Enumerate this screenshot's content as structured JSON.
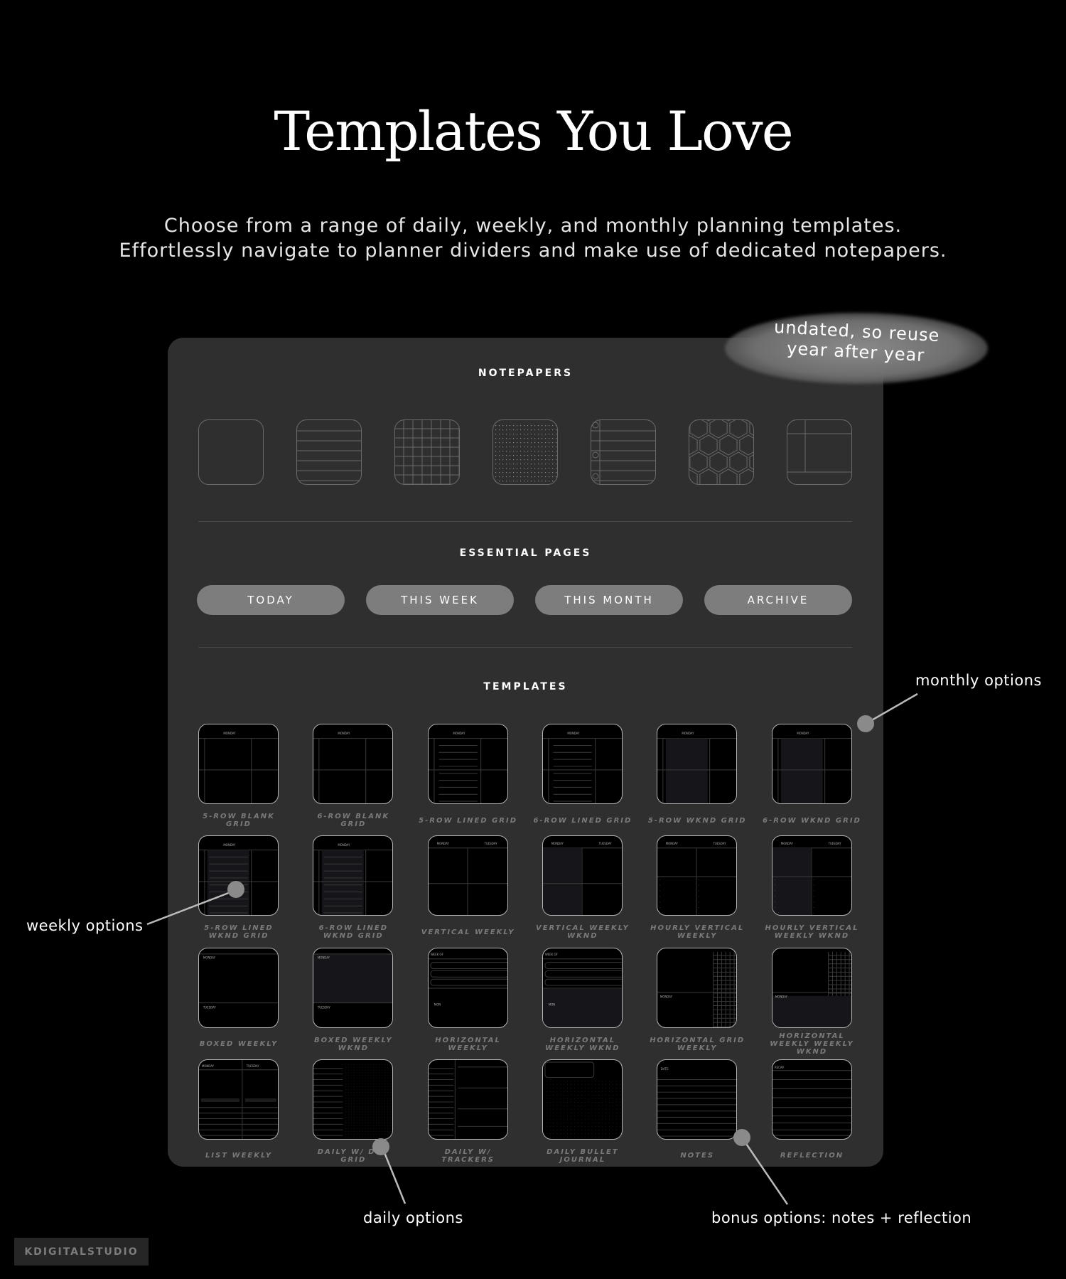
{
  "header": {
    "title": "Templates You Love",
    "subtitle_line1": "Choose from a range of daily, weekly, and monthly planning templates.",
    "subtitle_line2": "Effortlessly navigate to planner dividers and make use of dedicated notepapers."
  },
  "bubble": {
    "line1": "undated, so reuse",
    "line2": "year after year"
  },
  "notepapers": {
    "label": "NOTEPAPERS",
    "items": [
      {
        "icon": "blank-paper-icon",
        "style": "blank"
      },
      {
        "icon": "lined-paper-icon",
        "style": "lined"
      },
      {
        "icon": "grid-paper-icon",
        "style": "grid"
      },
      {
        "icon": "dot-grid-paper-icon",
        "style": "dot"
      },
      {
        "icon": "notebook-paper-icon",
        "style": "notebook"
      },
      {
        "icon": "hexagon-paper-icon",
        "style": "hex"
      },
      {
        "icon": "cornell-paper-icon",
        "style": "cornell"
      }
    ]
  },
  "essential": {
    "label": "ESSENTIAL PAGES",
    "buttons": [
      "TODAY",
      "THIS WEEK",
      "THIS MONTH",
      "ARCHIVE"
    ]
  },
  "templates": {
    "label": "TEMPLATES",
    "items": [
      {
        "label": "5-ROW BLANK GRID",
        "style": "cols",
        "head": "MONDAY"
      },
      {
        "label": "6-ROW BLANK GRID",
        "style": "cols",
        "head": "MONDAY"
      },
      {
        "label": "5-ROW LINED GRID",
        "style": "lined",
        "head": "MONDAY"
      },
      {
        "label": "6-ROW LINED GRID",
        "style": "lined",
        "head": "MONDAY"
      },
      {
        "label": "5-ROW WKND GRID",
        "style": "wknd",
        "head": "MONDAY"
      },
      {
        "label": "6-ROW WKND GRID",
        "style": "wknd",
        "head": "MONDAY"
      },
      {
        "label": "5-ROW LINED WKND GRID",
        "style": "linedwknd",
        "head": "MONDAY"
      },
      {
        "label": "6-ROW LINED WKND GRID",
        "style": "linedwknd",
        "head": "MONDAY"
      },
      {
        "label": "VERTICAL WEEKLY",
        "style": "vertical",
        "head": "MONDAY",
        "head2": "TUESDAY"
      },
      {
        "label": "VERTICAL WEEKLY WKND",
        "style": "verticalwknd",
        "head": "MONDAY",
        "head2": "TUESDAY"
      },
      {
        "label": "HOURLY VERTICAL WEEKLY",
        "style": "hourly",
        "head": "MONDAY",
        "head2": "TUESDAY"
      },
      {
        "label": "HOURLY VERTICAL WEEKLY WKND",
        "style": "hourlywknd",
        "head": "MONDAY",
        "head2": "TUESDAY"
      },
      {
        "label": "BOXED WEEKLY",
        "style": "boxed",
        "head": "MONDAY",
        "head2": "TUESDAY"
      },
      {
        "label": "BOXED WEEKLY WKND",
        "style": "boxedwknd",
        "head": "MONDAY",
        "head2": "TUESDAY"
      },
      {
        "label": "HORIZONTAL WEEKLY",
        "style": "horizontal",
        "head": "WEEK OF",
        "head2": "MON"
      },
      {
        "label": "HORIZONTAL WEEKLY WKND",
        "style": "horizontalwknd",
        "head": "WEEK OF",
        "head2": "MON"
      },
      {
        "label": "HORIZONTAL GRID WEEKLY",
        "style": "hgrid",
        "head": "",
        "head2": "MONDAY"
      },
      {
        "label": "HORIZONTAL WEEKLY WEEKLY WKND",
        "style": "hgridwknd",
        "head": "",
        "head2": "MONDAY"
      },
      {
        "label": "LIST WEEKLY",
        "style": "list",
        "head": "MONDAY",
        "head2": "TUESDAY"
      },
      {
        "label": "DAILY W/ DOT GRID",
        "style": "dotgrid",
        "head": ""
      },
      {
        "label": "DAILY W/ TRACKERS",
        "style": "trackers",
        "head": ""
      },
      {
        "label": "DAILY BULLET JOURNAL",
        "style": "bullet",
        "head": ""
      },
      {
        "label": "NOTES",
        "style": "notes",
        "head": "DATE:"
      },
      {
        "label": "REFLECTION",
        "style": "reflection",
        "head": "RECAP"
      }
    ]
  },
  "annotations": {
    "monthly": "monthly options",
    "weekly": "weekly options",
    "daily": "daily options",
    "bonus": "bonus options: notes + reflection"
  },
  "logo": "KDIGITALSTUDIO"
}
